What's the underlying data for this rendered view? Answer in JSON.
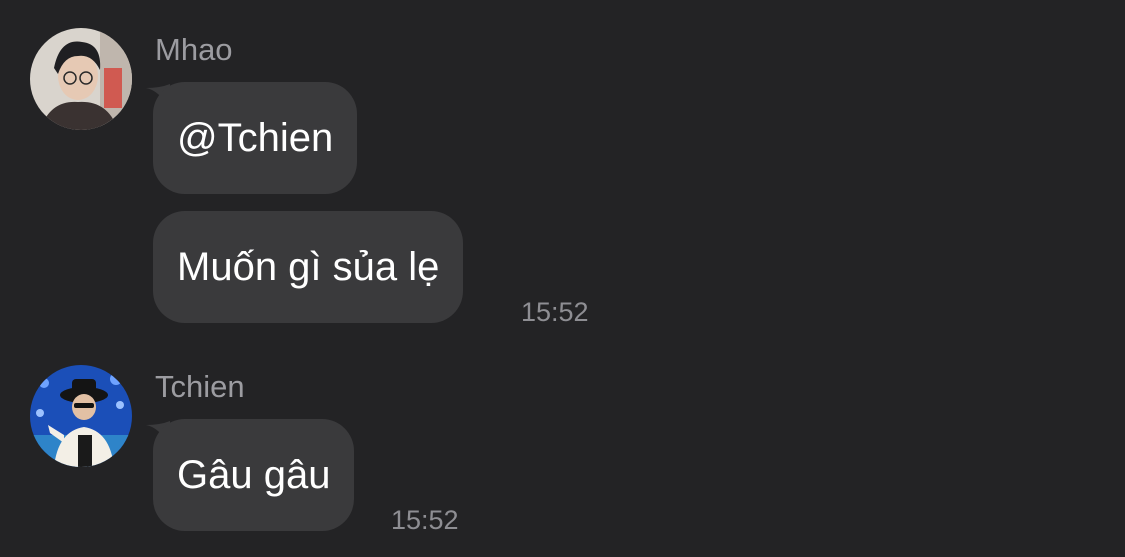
{
  "messages": [
    {
      "sender": "Mhao",
      "avatar_icon": "user-photo-avatar",
      "bubbles": [
        {
          "text": "@Tchien",
          "time": ""
        },
        {
          "text": "Muốn gì sủa lẹ",
          "time": "15:52"
        }
      ]
    },
    {
      "sender": "Tchien",
      "avatar_icon": "user-photo-avatar",
      "bubbles": [
        {
          "text": "Gâu gâu",
          "time": "15:52"
        }
      ]
    }
  ],
  "colors": {
    "background": "#232325",
    "bubble": "#3a3a3c",
    "sender_name": "#9c9ca1",
    "timestamp": "#8e8e93",
    "message_text": "#ffffff"
  }
}
